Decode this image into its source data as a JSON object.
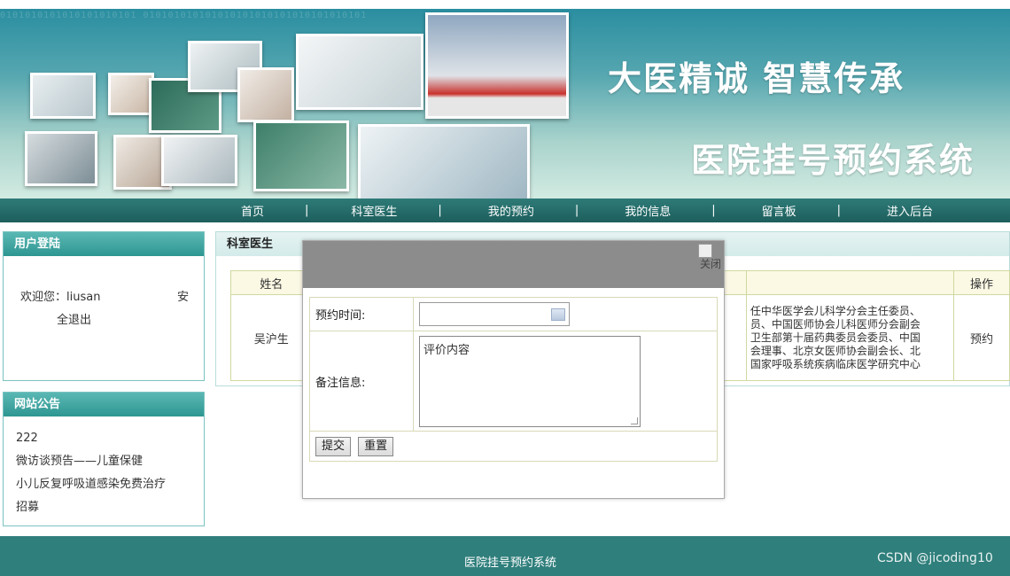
{
  "banner": {
    "binary_text": "0101010101010101010101 010101010101010101010101010101010101",
    "slogan_primary": "大医精诚 智慧传承",
    "slogan_secondary": "医院挂号预约系统"
  },
  "nav": {
    "items": [
      {
        "label": "首页"
      },
      {
        "label": "科室医生"
      },
      {
        "label": "我的预约"
      },
      {
        "label": "我的信息"
      },
      {
        "label": "留言板"
      },
      {
        "label": "进入后台"
      }
    ],
    "separator": "|"
  },
  "login_box": {
    "title": "用户登陆",
    "welcome": "欢迎您：liusan",
    "logout_part1": "安",
    "logout_part2": "全退出"
  },
  "notice_box": {
    "title": "网站公告",
    "items": [
      "222",
      "微访谈预告——儿童保健",
      "小儿反复呼吸道感染免费治疗",
      "招募"
    ]
  },
  "main": {
    "title": "科室医生",
    "columns": {
      "name": "姓名",
      "action": "操作"
    },
    "rows": [
      {
        "name": "吴沪生",
        "intro_lines": [
          "任中华医学会儿科学分会主任委员、",
          "员、中国医师协会儿科医师分会副会",
          "卫生部第十届药典委员会委员、中国",
          "会理事、北京女医师协会副会长、北",
          "国家呼吸系统疾病临床医学研究中心"
        ],
        "action": "预约"
      }
    ]
  },
  "modal": {
    "close_label": "关闭",
    "time_label": "预约时间:",
    "time_value": "",
    "memo_label": "备注信息:",
    "memo_value": "评价内容",
    "submit_label": "提交",
    "reset_label": "重置"
  },
  "footer": {
    "text": "医院挂号预约系统",
    "watermark": "CSDN @jicoding10"
  },
  "colors": {
    "nav_bg": "#1d5e5c",
    "box_header": "#2e9691",
    "footer_bg": "#2f7f7c",
    "modal_header": "#8c8c8c"
  }
}
